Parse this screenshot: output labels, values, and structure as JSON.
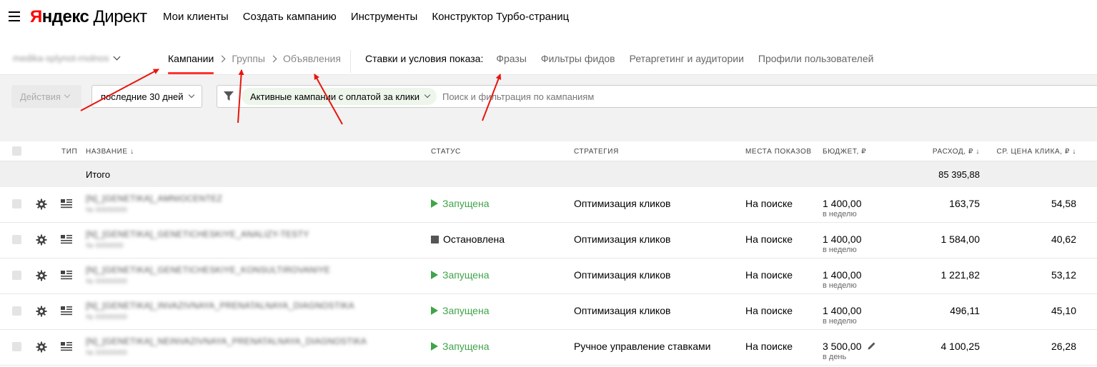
{
  "header": {
    "logo_yandex_y": "Я",
    "logo_yandex_rest": "ндекс",
    "logo_product": "Директ",
    "nav": [
      "Мои клиенты",
      "Создать кампанию",
      "Инструменты",
      "Конструктор Турбо-страниц"
    ]
  },
  "navrow": {
    "account_login": "medika-splynot-rnolnos",
    "breadcrumbs": [
      "Кампании",
      "Группы",
      "Объявления"
    ],
    "conditions_label": "Ставки и условия показа:",
    "conditions": [
      "Фразы",
      "Фильтры фидов",
      "Ретаргетинг и аудитории",
      "Профили пользователей"
    ]
  },
  "filters": {
    "actions_label": "Действия",
    "period_label": "последние 30 дней",
    "chip_label": "Активные кампании с оплатой за клики",
    "search_placeholder": "Поиск и фильтрация по кампаниям"
  },
  "table": {
    "headers": {
      "type": "тип",
      "name": "название ↓",
      "status": "статус",
      "strategy": "стратегия",
      "places": "места показов",
      "budget": "бюджет, ₽",
      "spend": "расход, ₽ ↓",
      "cpc": "ср. цена клика, ₽ ↓"
    },
    "total_label": "Итого",
    "total_spend": "85 395,88",
    "rows": [
      {
        "name": "[N]_[GENETIKA]_AMNIOCENTEZ",
        "id": "№ 00000000",
        "status": "Запущена",
        "status_type": "run",
        "strategy": "Оптимизация кликов",
        "places": "На поиске",
        "budget": "1 400,00",
        "budget_period": "в неделю",
        "spend": "163,75",
        "cpc": "54,58"
      },
      {
        "name": "[N]_[GENETIKA]_GENETICHESKIYE_ANALIZY-TESTY",
        "id": "№ 0000000",
        "status": "Остановлена",
        "status_type": "stop",
        "strategy": "Оптимизация кликов",
        "places": "На поиске",
        "budget": "1 400,00",
        "budget_period": "в неделю",
        "spend": "1 584,00",
        "cpc": "40,62"
      },
      {
        "name": "[N]_[GENETIKA]_GENETICHESKIYE_KONSULTIROVANIYE",
        "id": "№ 00000000",
        "status": "Запущена",
        "status_type": "run",
        "strategy": "Оптимизация кликов",
        "places": "На поиске",
        "budget": "1 400,00",
        "budget_period": "в неделю",
        "spend": "1 221,82",
        "cpc": "53,12"
      },
      {
        "name": "[N]_[GENETIKA]_INVAZIVNAYA_PRENATALNAYA_DIAGNOSTIKA",
        "id": "№ 00000000",
        "status": "Запущена",
        "status_type": "run",
        "strategy": "Оптимизация кликов",
        "places": "На поиске",
        "budget": "1 400,00",
        "budget_period": "в неделю",
        "spend": "496,11",
        "cpc": "45,10"
      },
      {
        "name": "[N]_[GENETIKA]_NEINVAZIVNAYA_PRENATALNAYA_DIAGNOSTIKA",
        "id": "№ 00000000",
        "status": "Запущена",
        "status_type": "run",
        "strategy": "Ручное управление ставками",
        "places": "На поиске",
        "budget": "3 500,00",
        "budget_period": "в день",
        "spend": "4 100,25",
        "cpc": "26,28"
      }
    ]
  },
  "colors": {
    "accent_red": "#ff3333",
    "status_running": "#3fa44a",
    "chip_bg": "#eef6ec",
    "annotation_arrow": "#e8150f"
  }
}
